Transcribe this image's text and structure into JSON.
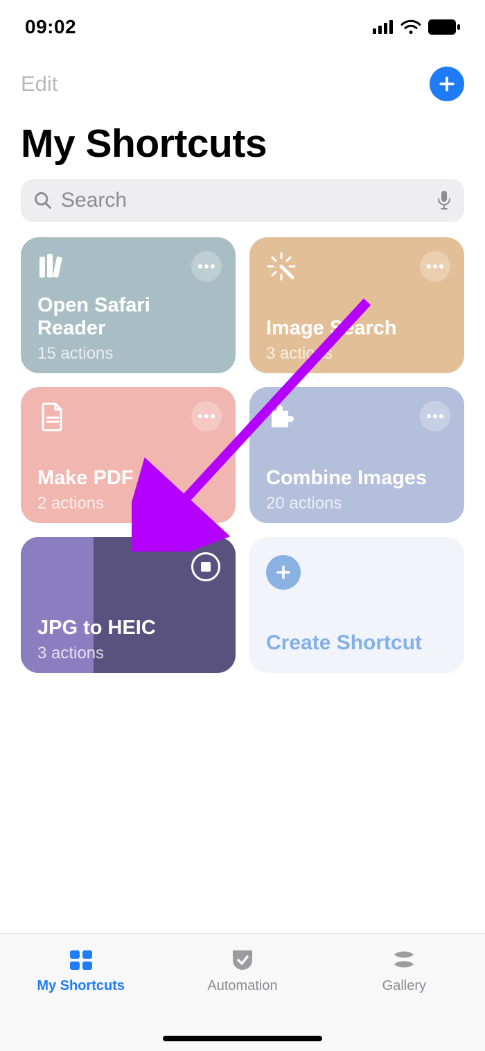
{
  "status": {
    "time": "09:02"
  },
  "nav": {
    "edit": "Edit"
  },
  "title": "My Shortcuts",
  "search": {
    "placeholder": "Search"
  },
  "tiles": [
    {
      "name": "Open Safari Reader",
      "sub": "15 actions",
      "color": "#a9bec4",
      "icon": "books"
    },
    {
      "name": "Image Search",
      "sub": "3 actions",
      "color": "#e3bf97",
      "icon": "wand"
    },
    {
      "name": "Make PDF",
      "sub": "2 actions",
      "color": "#f1b6af",
      "icon": "doc"
    },
    {
      "name": "Combine Images",
      "sub": "20 actions",
      "color": "#b4bfdc",
      "icon": "puzzle"
    },
    {
      "name": "JPG to HEIC",
      "sub": "3 actions",
      "color": "purple",
      "running": true
    }
  ],
  "create": {
    "label": "Create Shortcut"
  },
  "tabs": [
    {
      "label": "My Shortcuts",
      "active": true
    },
    {
      "label": "Automation",
      "active": false
    },
    {
      "label": "Gallery",
      "active": false
    }
  ]
}
